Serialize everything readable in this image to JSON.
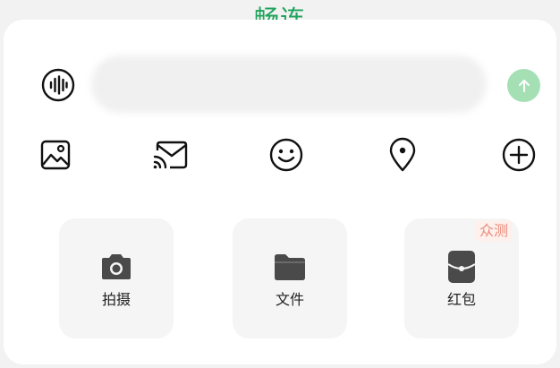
{
  "header": {
    "title": "畅连",
    "title_color": "#1fa35c"
  },
  "composer": {
    "voice_icon": "voice-waveform-icon",
    "input_value": "",
    "send_icon": "arrow-up-icon",
    "send_color": "#a5e0b5"
  },
  "toolbar": [
    {
      "name": "image",
      "icon": "image-icon"
    },
    {
      "name": "message",
      "icon": "cast-message-icon"
    },
    {
      "name": "emoji",
      "icon": "smiley-icon"
    },
    {
      "name": "location",
      "icon": "location-pin-icon"
    },
    {
      "name": "more",
      "icon": "plus-circle-icon"
    }
  ],
  "actions": [
    {
      "label": "拍摄",
      "icon": "camera-icon"
    },
    {
      "label": "文件",
      "icon": "folder-icon"
    },
    {
      "label": "红包",
      "icon": "red-packet-icon",
      "badge": "众测",
      "badge_color": "#e98a78"
    }
  ]
}
